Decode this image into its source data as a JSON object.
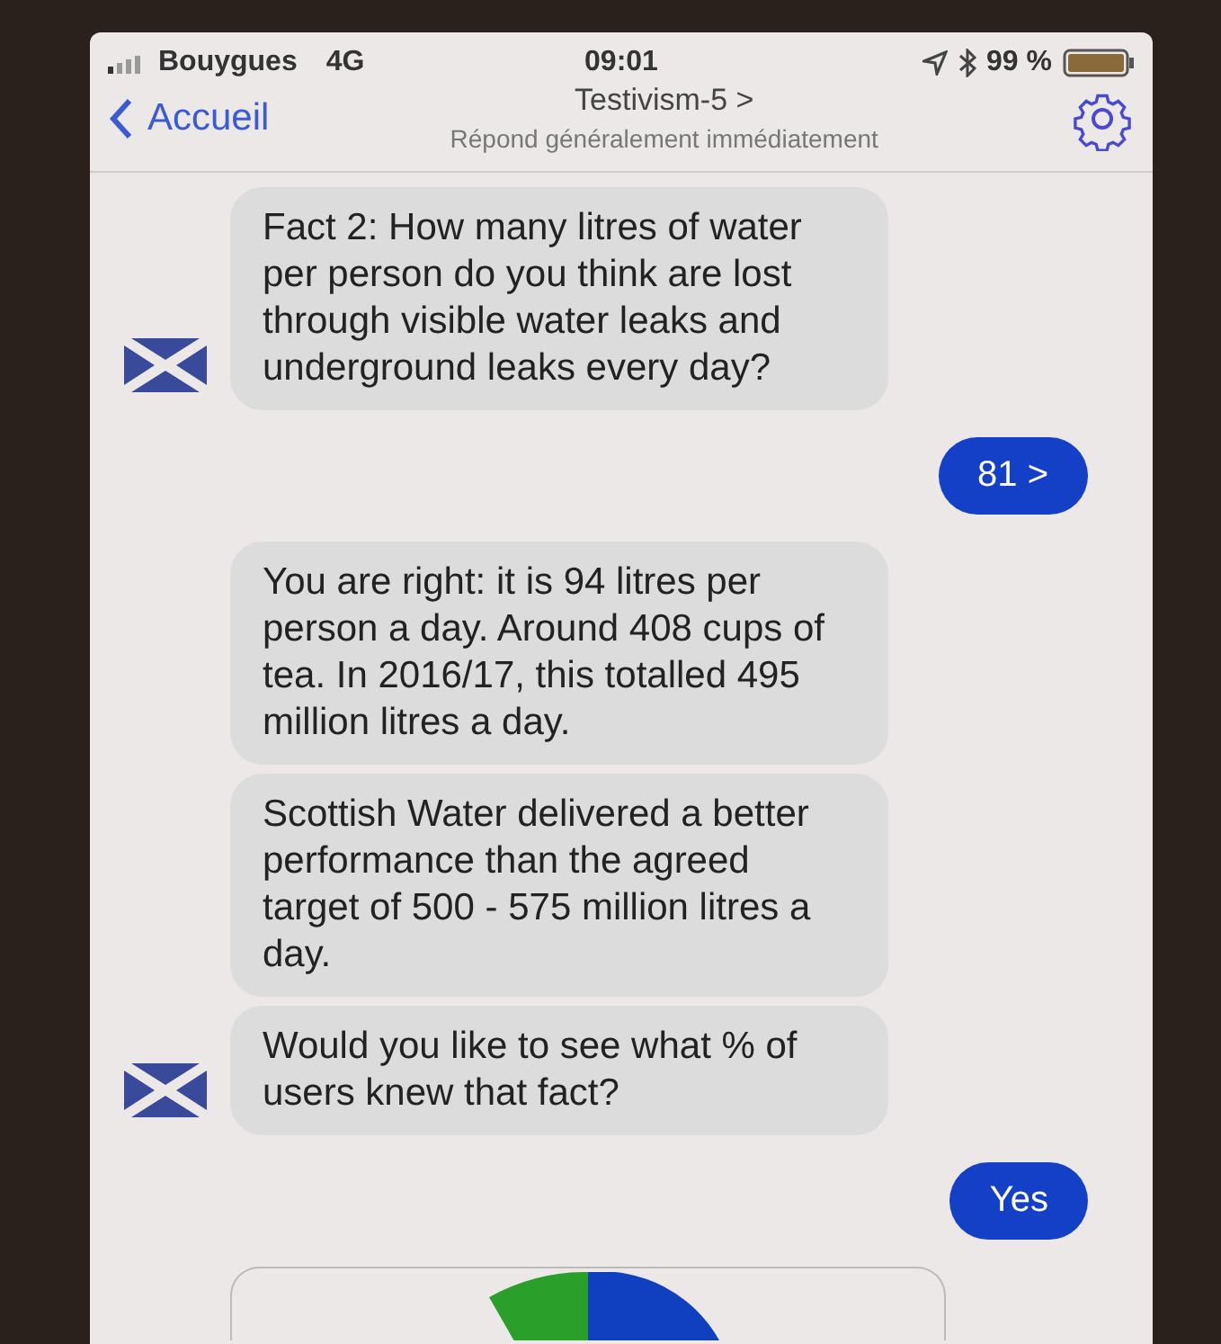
{
  "status_bar": {
    "carrier": "Bouygues",
    "network": "4G",
    "time": "09:01",
    "battery": "99 %"
  },
  "nav": {
    "back": "Accueil",
    "title": "Testivism-5 >",
    "subtitle": "Répond généralement immédiatement"
  },
  "messages": [
    {
      "kind": "bot",
      "avatar": true,
      "text": "Fact 2: How many litres of water per person do you think are lost through visible water leaks and underground leaks every day?"
    },
    {
      "kind": "user",
      "text": "81 >"
    },
    {
      "kind": "bot",
      "avatar": false,
      "text": "You are right: it is 94 litres per person a day. Around 408 cups of tea. In 2016/17, this totalled 495 million litres a day."
    },
    {
      "kind": "bot",
      "avatar": false,
      "text": "Scottish Water delivered a better performance than the agreed target of 500 - 575 million litres a day."
    },
    {
      "kind": "bot",
      "avatar": true,
      "text": "Would you like to see what % of users knew that fact?"
    },
    {
      "kind": "user",
      "text": "Yes"
    },
    {
      "kind": "chart"
    }
  ]
}
